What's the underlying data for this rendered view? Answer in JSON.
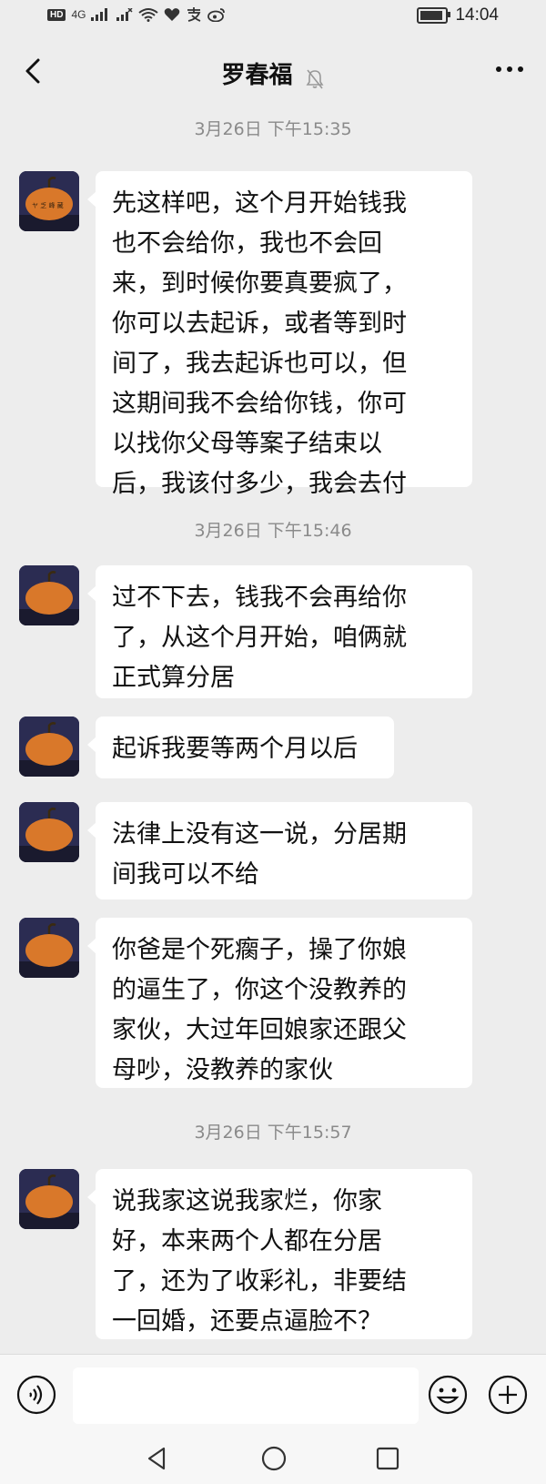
{
  "status_bar": {
    "hd": "HD",
    "network": "4G",
    "time": "14:04"
  },
  "header": {
    "title": "罗春福"
  },
  "timestamps": [
    "3月26日 下午15:35",
    "3月26日 下午15:46",
    "3月26日 下午15:57"
  ],
  "messages": [
    {
      "lines": [
        "先这样吧，这个月开始钱我",
        "也不会给你，我也不会回",
        "来，到时候你要真要疯了，",
        "你可以去起诉，或者等到时",
        "间了，我去起诉也可以，但",
        "这期间我不会给你钱，你可",
        "以找你父母等案子结束以",
        "后，我该付多少，我会去付"
      ]
    },
    {
      "lines": [
        "过不下去，钱我不会再给你",
        "了，从这个月开始，咱俩就",
        "正式算分居"
      ]
    },
    {
      "lines": [
        "起诉我要等两个月以后"
      ]
    },
    {
      "lines": [
        "法律上没有这一说，分居期",
        "间我可以不给"
      ]
    },
    {
      "lines": [
        "你爸是个死瘸子，操了你娘",
        "的逼生了，你这个没教养的",
        "家伙，大过年回娘家还跟父",
        "母吵，没教养的家伙"
      ]
    },
    {
      "lines": [
        "说我家这说我家烂，你家",
        "好，本来两个人都在分居",
        "了，还为了收彩礼，非要结",
        "一回婚，还要点逼脸不？"
      ]
    }
  ],
  "input": {
    "placeholder": ""
  },
  "colors": {
    "background": "#ededed",
    "bubble": "#ffffff",
    "timestamp": "#8a8a8a"
  }
}
